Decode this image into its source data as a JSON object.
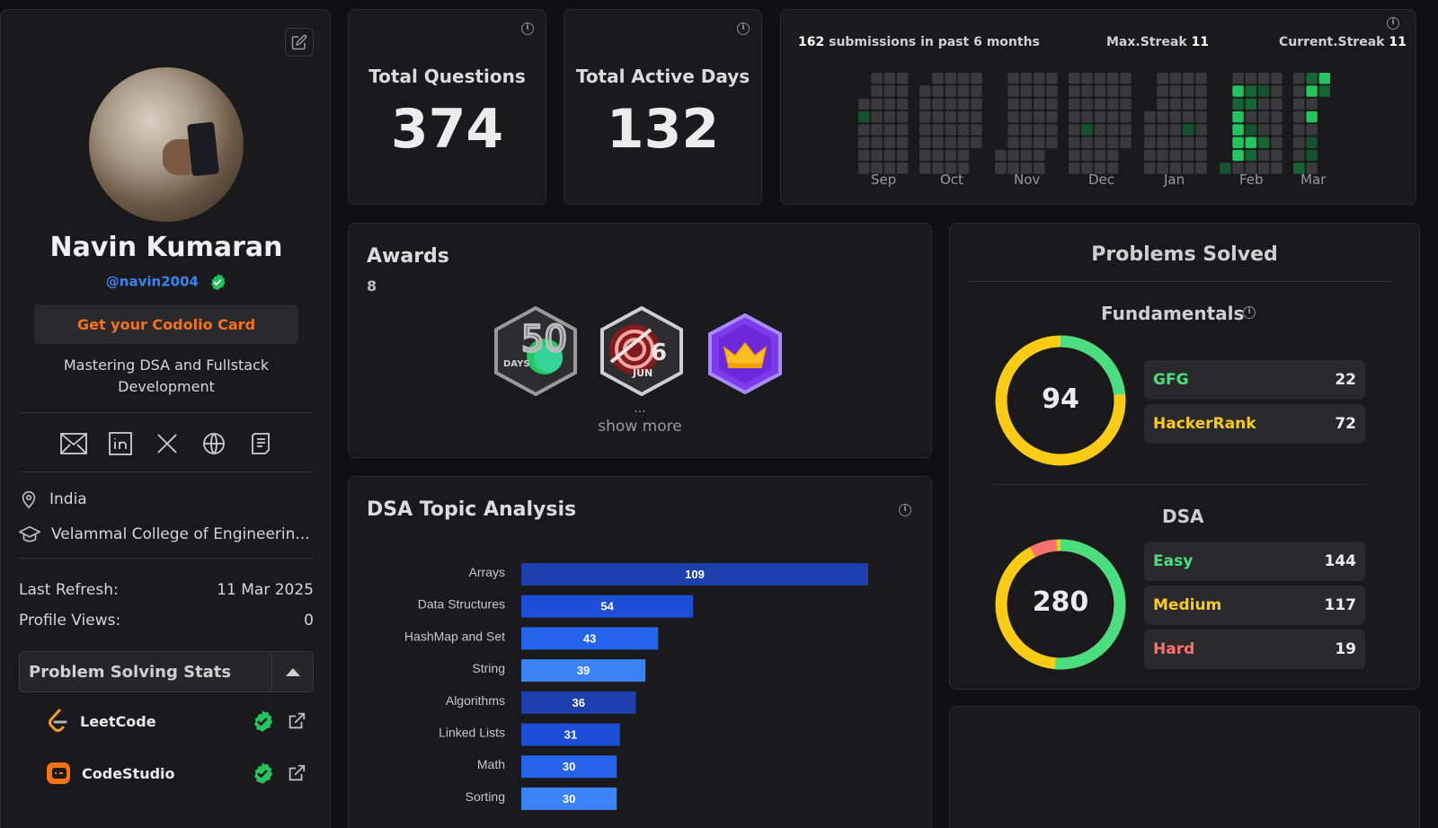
{
  "profile": {
    "name": "Navin Kumaran",
    "handle": "@navin2004",
    "codolio_button": "Get your Codolio Card",
    "bio": "Mastering DSA and Fullstack Development",
    "location": "India",
    "college": "Velammal College of Engineerin...",
    "last_refresh_label": "Last Refresh:",
    "last_refresh_value": "11 Mar 2025",
    "profile_views_label": "Profile Views:",
    "profile_views_value": "0",
    "problem_solving_stats_label": "Problem Solving Stats",
    "platforms": [
      {
        "name": "LeetCode",
        "icon": "leetcode-icon",
        "color": "#f89f1b"
      },
      {
        "name": "CodeStudio",
        "icon": "codestudio-icon",
        "color": "#f97316"
      }
    ],
    "social_icons": [
      "mail-icon",
      "linkedin-icon",
      "x-icon",
      "globe-icon",
      "resume-icon"
    ]
  },
  "stats": {
    "total_questions_label": "Total Questions",
    "total_questions_value": "374",
    "total_active_days_label": "Total Active Days",
    "total_active_days_value": "132"
  },
  "heatmap": {
    "submissions_count": "162",
    "submissions_text": "submissions in past 6 months",
    "max_streak_label": "Max.Streak",
    "max_streak_value": "11",
    "current_streak_label": "Current.Streak",
    "current_streak_value": "11",
    "months": [
      "Sep",
      "Oct",
      "Nov",
      "Dec",
      "Jan",
      "Feb",
      "Mar"
    ],
    "colors": {
      "empty": "#3a3a3d",
      "low": "#14532d",
      "mid": "#166534",
      "high": "#22c55e"
    }
  },
  "awards": {
    "title": "Awards",
    "count": "8",
    "badges": [
      {
        "name": "50-days-badge",
        "text_top": "50",
        "text_bottom": "DAYS"
      },
      {
        "name": "jun-6-badge",
        "text_top": "6",
        "text_bottom": "JUN"
      },
      {
        "name": "crown-badge",
        "icon": "crown-icon"
      }
    ],
    "ellipsis": "...",
    "show_more": "show more"
  },
  "dsa": {
    "title": "DSA Topic Analysis"
  },
  "chart_data": {
    "type": "bar",
    "orientation": "horizontal",
    "categories": [
      "Arrays",
      "Data Structures",
      "HashMap and Set",
      "String",
      "Algorithms",
      "Linked Lists",
      "Math",
      "Sorting"
    ],
    "values": [
      109,
      54,
      43,
      39,
      36,
      31,
      30,
      30
    ],
    "bar_colors": [
      "#1e40af",
      "#1d4ed8",
      "#2563eb",
      "#3b82f6",
      "#1e40af",
      "#1d4ed8",
      "#2563eb",
      "#3b82f6"
    ],
    "title": "DSA Topic Analysis",
    "xlabel": "",
    "ylabel": ""
  },
  "problems_solved": {
    "title": "Problems Solved",
    "fundamentals": {
      "title": "Fundamentals",
      "total": "94",
      "items": [
        {
          "label": "GFG",
          "value": "22",
          "color": "#4ade80"
        },
        {
          "label": "HackerRank",
          "value": "72",
          "color": "#facc15"
        }
      ]
    },
    "dsa": {
      "title": "DSA",
      "total": "280",
      "items": [
        {
          "label": "Easy",
          "value": "144",
          "color": "#4ade80"
        },
        {
          "label": "Medium",
          "value": "117",
          "color": "#facc15"
        },
        {
          "label": "Hard",
          "value": "19",
          "color": "#f87171"
        }
      ]
    }
  }
}
